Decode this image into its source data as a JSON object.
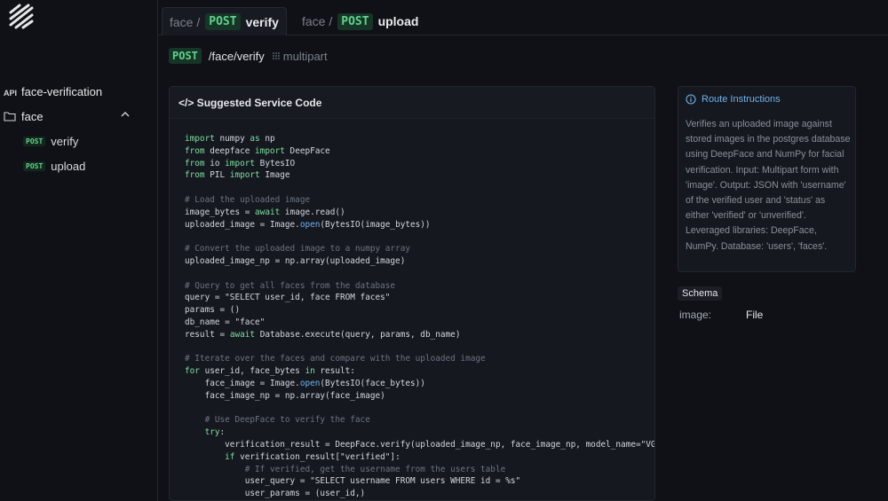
{
  "sidebar": {
    "api_tag": "API",
    "api_name": "face-verification",
    "folder": "face",
    "items": [
      {
        "method": "POST",
        "label": "verify"
      },
      {
        "method": "POST",
        "label": "upload"
      }
    ]
  },
  "tabs": [
    {
      "prefix": "face /",
      "method": "POST",
      "name": "verify"
    },
    {
      "prefix": "face /",
      "method": "POST",
      "name": "upload"
    }
  ],
  "route": {
    "method": "POST",
    "path": "/face/verify",
    "content_type": "multipart"
  },
  "code_panel": {
    "title": "</> Suggested Service Code",
    "lines": [
      "import numpy as np",
      "from deepface import DeepFace",
      "from io import BytesIO",
      "from PIL import Image",
      "",
      "# Load the uploaded image",
      "image_bytes = await image.read()",
      "uploaded_image = Image.open(BytesIO(image_bytes))",
      "",
      "# Convert the uploaded image to a numpy array",
      "uploaded_image_np = np.array(uploaded_image)",
      "",
      "# Query to get all faces from the database",
      "query = \"SELECT user_id, face FROM faces\"",
      "params = ()",
      "db_name = \"face\"",
      "result = await Database.execute(query, params, db_name)",
      "",
      "# Iterate over the faces and compare with the uploaded image",
      "for user_id, face_bytes in result:",
      "    face_image = Image.open(BytesIO(face_bytes))",
      "    face_image_np = np.array(face_image)",
      "",
      "    # Use DeepFace to verify the face",
      "    try:",
      "        verification_result = DeepFace.verify(uploaded_image_np, face_image_np, model_name=\"VGG-F",
      "        if verification_result[\"verified\"]:",
      "            # If verified, get the username from the users table",
      "            user_query = \"SELECT username FROM users WHERE id = %s\"",
      "            user_params = (user_id,)"
    ]
  },
  "instructions": {
    "title": "Route Instructions",
    "body": "Verifies an uploaded image against stored images in the postgres database using DeepFace and NumPy for facial verification. Input: Multipart form with 'image'. Output: JSON with 'username' of the verified user and 'status' as either 'verified' or 'unverified'. Leveraged libraries: DeepFace, NumPy. Database: 'users', 'faces'."
  },
  "schema": {
    "label": "Schema",
    "fields": [
      {
        "key": "image:",
        "type": "File"
      }
    ]
  },
  "colors": {
    "accent_green": "#5fd38b",
    "accent_blue": "#6fb3f0",
    "background": "#0f1116"
  }
}
